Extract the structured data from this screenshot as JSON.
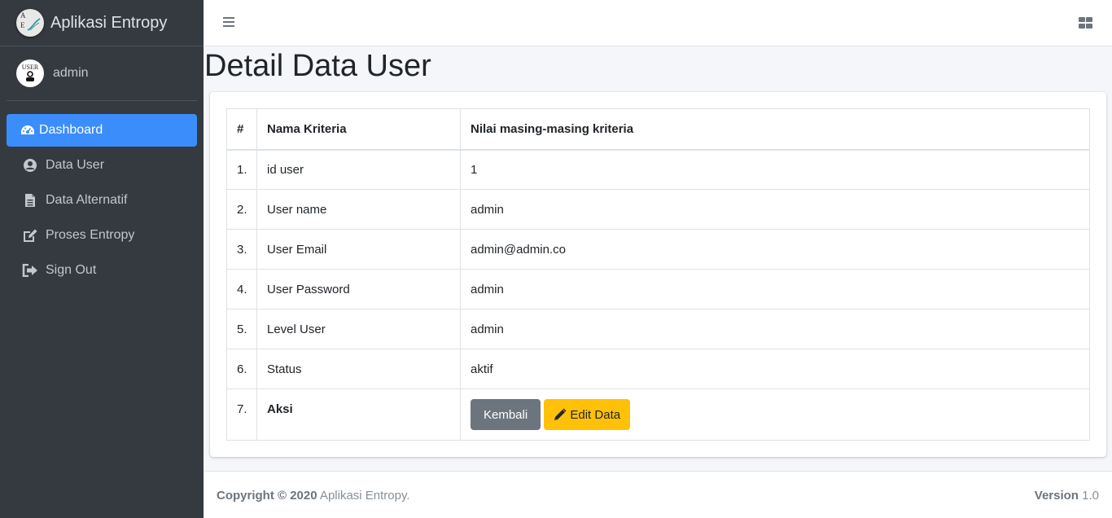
{
  "brand": {
    "name": "Aplikasi Entropy",
    "logo_letters": [
      "A",
      "E"
    ]
  },
  "user": {
    "name": "admin",
    "avatar_text": "USER"
  },
  "nav": [
    {
      "label": "Dashboard",
      "icon": "tachometer-icon",
      "active": true
    },
    {
      "label": "Data User",
      "icon": "user-circle-icon"
    },
    {
      "label": "Data Alternatif",
      "icon": "file-icon"
    },
    {
      "label": "Proses Entropy",
      "icon": "edit-icon"
    },
    {
      "label": "Sign Out",
      "icon": "sign-out-icon"
    }
  ],
  "page": {
    "title": "Detail Data User"
  },
  "table": {
    "headers": [
      "#",
      "Nama Kriteria",
      "Nilai masing-masing kriteria"
    ],
    "rows": [
      {
        "no": "1.",
        "name": "id user",
        "value": "1"
      },
      {
        "no": "2.",
        "name": "User name",
        "value": "admin"
      },
      {
        "no": "3.",
        "name": "User Email",
        "value": "admin@admin.co"
      },
      {
        "no": "4.",
        "name": "User Password",
        "value": "admin"
      },
      {
        "no": "5.",
        "name": "Level User",
        "value": "admin"
      },
      {
        "no": "6.",
        "name": "Status",
        "value": "aktif"
      }
    ],
    "action_row": {
      "no": "7.",
      "name": "Aksi",
      "back_label": "Kembali",
      "edit_label": "Edit Data"
    }
  },
  "footer": {
    "copyright_bold": "Copyright © 2020",
    "copyright_text": " Aplikasi Entropy.",
    "version_label": "Version",
    "version_value": "1.0"
  },
  "colors": {
    "sidebar": "#343a40",
    "active": "#3c8dfc",
    "warning": "#ffc107",
    "secondary": "#6c757d"
  }
}
